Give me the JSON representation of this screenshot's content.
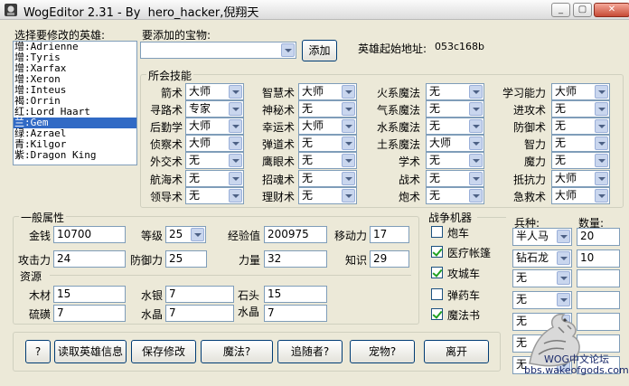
{
  "window": {
    "title": "WogEditor 2.31 - By  hero_hacker,倪翔天",
    "minimize_label": "_",
    "maximize_label": "▢",
    "close_label": "✕"
  },
  "hero_select": {
    "label": "选择要修改的英雄:",
    "items": [
      "增:Adrienne",
      "增:Tyris",
      "增:Xarfax",
      "增:Xeron",
      "增:Inteus",
      "褐:Orrin",
      "红:Lord Haart",
      "兰:Gem",
      "绿:Azrael",
      "青:Kilgor",
      "紫:Dragon King"
    ],
    "selected_index": 7
  },
  "artifact": {
    "label": "要添加的宝物:",
    "value": "",
    "add_button": "添加"
  },
  "address": {
    "label": "英雄起始地址:",
    "value": "053c168b"
  },
  "skills": {
    "title": "所会技能",
    "items": [
      {
        "name": "箭术",
        "value": "大师"
      },
      {
        "name": "寻路术",
        "value": "专家"
      },
      {
        "name": "后勤学",
        "value": "大师"
      },
      {
        "name": "侦察术",
        "value": "大师"
      },
      {
        "name": "外交术",
        "value": "无"
      },
      {
        "name": "航海术",
        "value": "无"
      },
      {
        "name": "领导术",
        "value": "无"
      },
      {
        "name": "智慧术",
        "value": "大师"
      },
      {
        "name": "神秘术",
        "value": "无"
      },
      {
        "name": "幸运术",
        "value": "大师"
      },
      {
        "name": "弹道术",
        "value": "无"
      },
      {
        "name": "鹰眼术",
        "value": "无"
      },
      {
        "name": "招魂术",
        "value": "无"
      },
      {
        "name": "理财术",
        "value": "无"
      },
      {
        "name": "火系魔法",
        "value": "无"
      },
      {
        "name": "气系魔法",
        "value": "无"
      },
      {
        "name": "水系魔法",
        "value": "无"
      },
      {
        "name": "土系魔法",
        "value": "大师"
      },
      {
        "name": "学术",
        "value": "无"
      },
      {
        "name": "战术",
        "value": "无"
      },
      {
        "name": "炮术",
        "value": "无"
      },
      {
        "name": "学习能力",
        "value": "大师"
      },
      {
        "name": "进攻术",
        "value": "无"
      },
      {
        "name": "防御术",
        "value": "无"
      },
      {
        "name": "智力",
        "value": "无"
      },
      {
        "name": "魔力",
        "value": "无"
      },
      {
        "name": "抵抗力",
        "value": "大师"
      },
      {
        "name": "急救术",
        "value": "大师"
      }
    ]
  },
  "general": {
    "title": "一般属性",
    "gold_label": "金钱",
    "gold": "10700",
    "level_label": "等级",
    "level": "25",
    "exp_label": "经验值",
    "exp": "200975",
    "move_label": "移动力",
    "move": "17",
    "attack_label": "攻击力",
    "attack": "24",
    "defense_label": "防御力",
    "defense": "25",
    "power_label": "力量",
    "power": "32",
    "knowledge_label": "知识",
    "knowledge": "29"
  },
  "resources": {
    "title": "资源",
    "wood_label": "木材",
    "wood": "15",
    "sulfur_label": "硫磺",
    "sulfur": "7",
    "mercury_label": "水银",
    "mercury": "7",
    "crystal_label": "水晶",
    "crystal": "7",
    "ore_label": "石头",
    "ore": "15",
    "gems_label": "水晶",
    "gems": "7"
  },
  "war_machines": {
    "title": "战争机器",
    "items": [
      {
        "label": "炮车",
        "checked": false
      },
      {
        "label": "医疗帐篷",
        "checked": true
      },
      {
        "label": "攻城车",
        "checked": true
      },
      {
        "label": "弹药车",
        "checked": false
      },
      {
        "label": "魔法书",
        "checked": true
      }
    ]
  },
  "troops": {
    "type_label": "兵种:",
    "count_label": "数量:",
    "slots": [
      {
        "type": "半人马",
        "count": "20"
      },
      {
        "type": "钻石龙",
        "count": "10"
      },
      {
        "type": "无",
        "count": ""
      },
      {
        "type": "无",
        "count": ""
      },
      {
        "type": "无",
        "count": ""
      },
      {
        "type": "无",
        "count": ""
      },
      {
        "type": "无",
        "count": ""
      }
    ]
  },
  "buttons": {
    "help": "?",
    "read": "读取英雄信息",
    "save": "保存修改",
    "magic": "魔法?",
    "followers": "追随者?",
    "pets": "宠物?",
    "exit": "离开"
  },
  "watermark": {
    "line1": "WOG中文论坛",
    "line2": "bbs.wakeofgods.com"
  }
}
